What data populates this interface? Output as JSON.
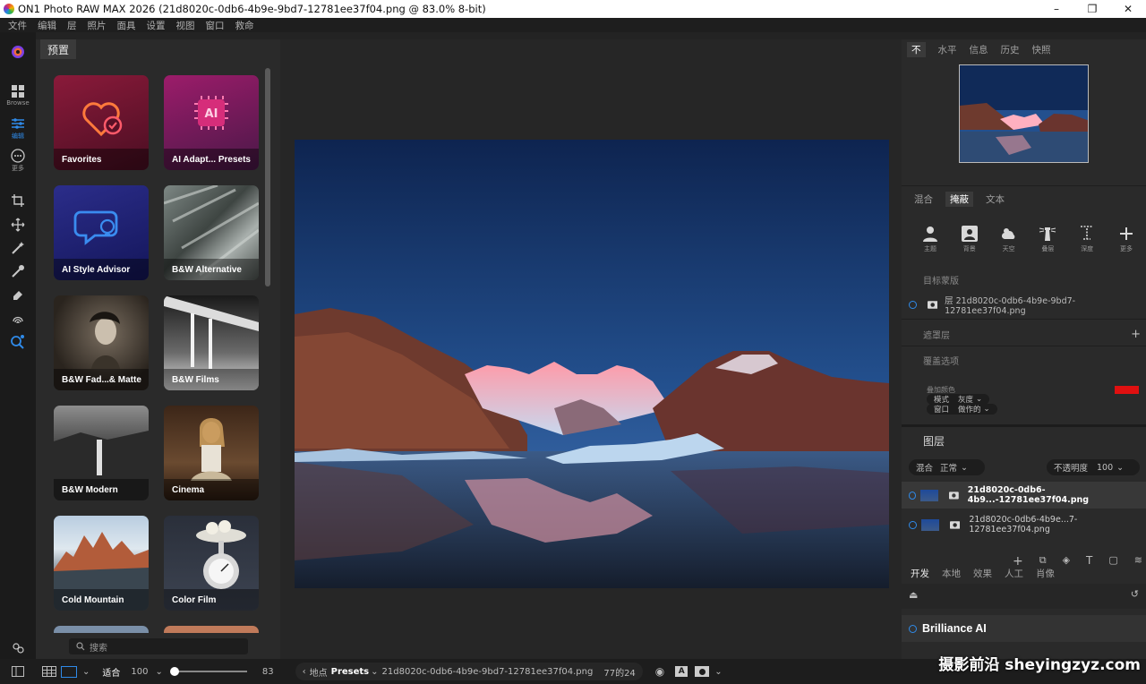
{
  "titlebar": {
    "title": "ON1 Photo RAW MAX 2026 (21d8020c-0db6-4b9e-9bd7-12781ee37f04.png @ 83.0% 8-bit)",
    "min": "–",
    "max": "❐",
    "close": "✕"
  },
  "menu": [
    "文件",
    "编辑",
    "层",
    "照片",
    "面具",
    "设置",
    "视图",
    "窗口",
    "救命"
  ],
  "tools": {
    "browse_label": "Browse",
    "edit_label": "编辑",
    "more_label": "更多"
  },
  "presets": {
    "tab_label": "预置",
    "search_placeholder": "搜索",
    "cards": [
      {
        "label": "Favorites"
      },
      {
        "label": "AI Adapt... Presets"
      },
      {
        "label": "AI Style Advisor"
      },
      {
        "label": "B&W Alternative"
      },
      {
        "label": "B&W Fad...& Matte"
      },
      {
        "label": "B&W Films"
      },
      {
        "label": "B&W Modern"
      },
      {
        "label": "Cinema"
      },
      {
        "label": "Cold Mountain"
      },
      {
        "label": "Color Film"
      }
    ]
  },
  "right": {
    "top_tabs": [
      "不",
      "水平",
      "信息",
      "历史",
      "快照"
    ],
    "mask_tabs": [
      "混合",
      "掩蔽",
      "文本"
    ],
    "mask_icons": [
      {
        "label": "主题"
      },
      {
        "label": "背景"
      },
      {
        "label": "天空"
      },
      {
        "label": "叠层"
      },
      {
        "label": "深度"
      },
      {
        "label": "更多"
      }
    ],
    "target_label": "目标蒙版",
    "target_layer": "层 21d8020c-0db6-4b9e-9bd7-12781ee37f04.png",
    "mask_layer_label": "遮罩层",
    "overlay_label": "覆盖选项",
    "overlay_color_label": "叠加颜色",
    "mode_label": "模式",
    "mode_value": "灰度",
    "window_label": "窗口",
    "window_value": "做作的",
    "overlay_color": "#e01010",
    "layers_title": "图层",
    "blend_label": "混合",
    "blend_value": "正常",
    "opacity_label": "不透明度",
    "opacity_value": "100",
    "layers": [
      {
        "name": "21d8020c-0db6-4b9...-12781ee37f04.png"
      },
      {
        "name": "21d8020c-0db6-4b9e...7-12781ee37f04.png"
      }
    ],
    "bottom_tabs": [
      "开发",
      "本地",
      "效果",
      "人工",
      "肖像"
    ],
    "brilliance_label": "Brilliance AI"
  },
  "status": {
    "fit_label": "适合",
    "zoom_value": "100",
    "slider_value": "83",
    "location_label": "地点",
    "preset_label": "Presets",
    "filename": "21d8020c-0db6-4b9e-9bd7-12781ee37f04.png",
    "counter": "77的24"
  },
  "watermark": "摄影前沿 sheyingzyz.com",
  "colors": {
    "accent": "#2f8ae8",
    "overlay": "#e01010"
  }
}
